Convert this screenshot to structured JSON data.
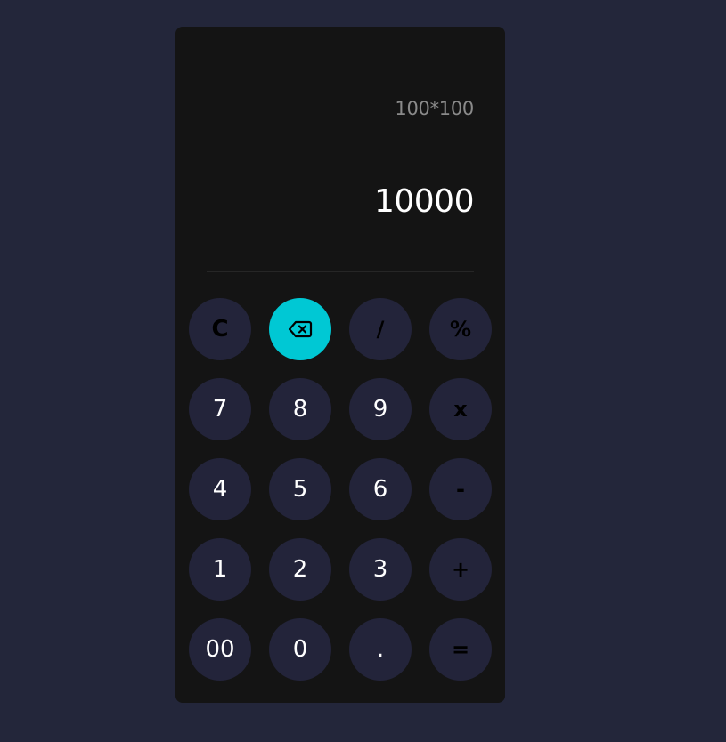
{
  "display": {
    "expression": "100*100",
    "result": "10000"
  },
  "keys": {
    "clear": "C",
    "backspace_icon": "backspace-icon",
    "divide": "/",
    "percent": "%",
    "seven": "7",
    "eight": "8",
    "nine": "9",
    "multiply": "x",
    "four": "4",
    "five": "5",
    "six": "6",
    "minus": "-",
    "one": "1",
    "two": "2",
    "three": "3",
    "plus": "+",
    "double_zero": "00",
    "zero": "0",
    "decimal": ".",
    "equals": "="
  },
  "colors": {
    "background": "#23263a",
    "panel": "#141414",
    "key": "#23243a",
    "accent": "#00c8d4",
    "expression_text": "#8a8a8a",
    "result_text": "#ffffff"
  }
}
